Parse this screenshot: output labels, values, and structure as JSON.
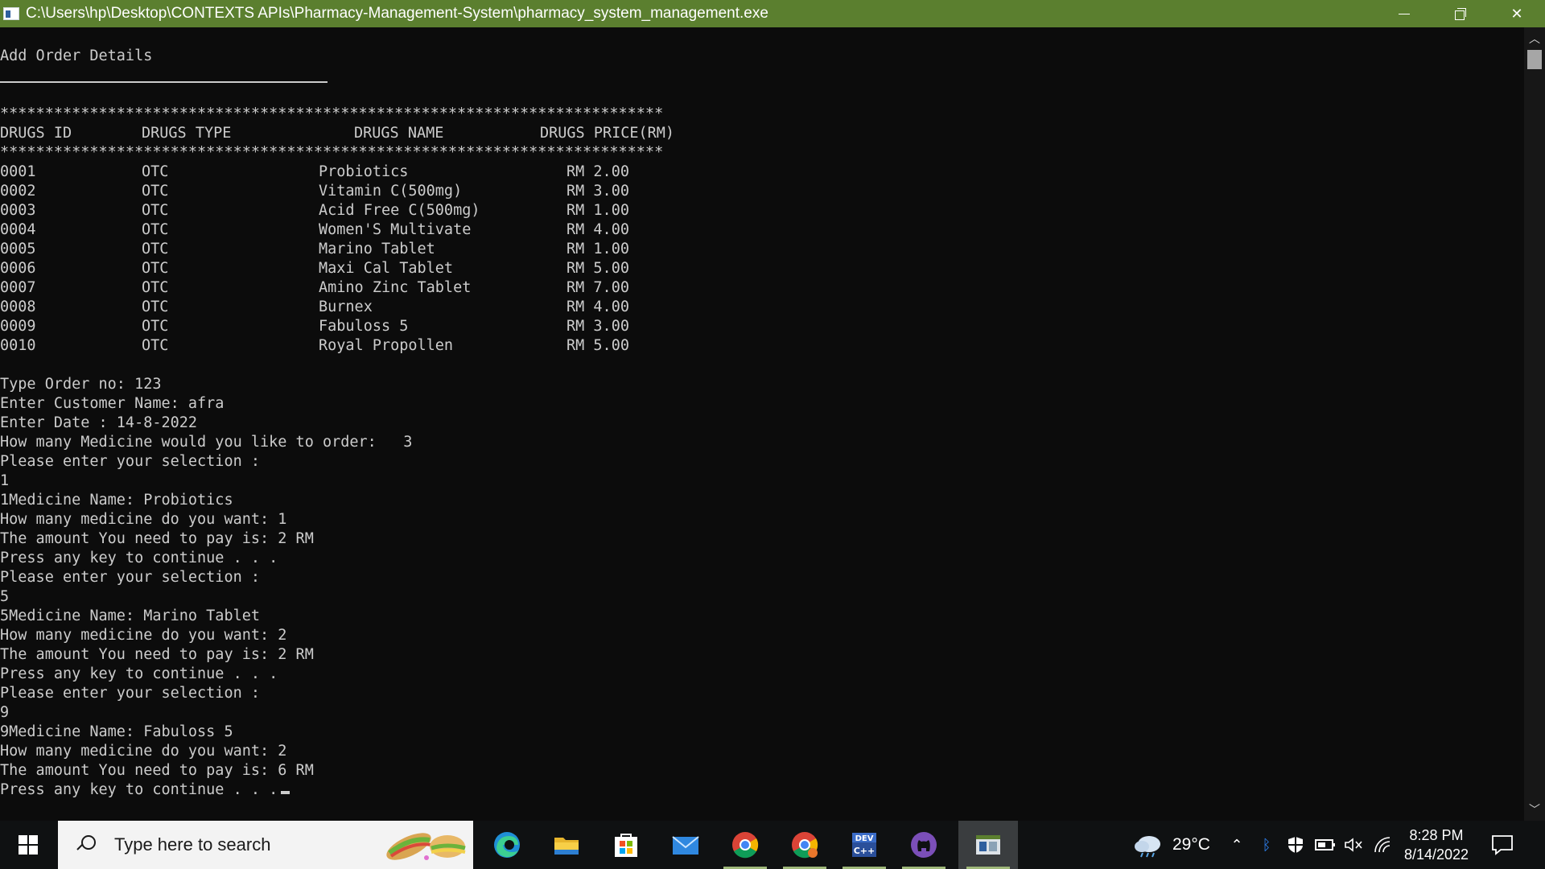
{
  "window": {
    "title": "C:\\Users\\hp\\Desktop\\CONTEXTS APIs\\Pharmacy-Management-System\\pharmacy_system_management.exe",
    "minimize_icon": "minimize-icon",
    "maximize_icon": "restore-icon",
    "close_glyph": "✕"
  },
  "console": {
    "heading": "Add Order Details",
    "separator": "**************************************************************************",
    "headers": [
      "DRUGS ID",
      "DRUGS TYPE",
      "DRUGS NAME",
      "DRUGS PRICE(RM)"
    ],
    "rows": [
      {
        "id": "0001",
        "type": "OTC",
        "name": "Probiotics",
        "price": "RM 2.00"
      },
      {
        "id": "0002",
        "type": "OTC",
        "name": "Vitamin C(500mg)",
        "price": "RM 3.00"
      },
      {
        "id": "0003",
        "type": "OTC",
        "name": "Acid Free C(500mg)",
        "price": "RM 1.00"
      },
      {
        "id": "0004",
        "type": "OTC",
        "name": "Women'S Multivate",
        "price": "RM 4.00"
      },
      {
        "id": "0005",
        "type": "OTC",
        "name": "Marino Tablet",
        "price": "RM 1.00"
      },
      {
        "id": "0006",
        "type": "OTC",
        "name": "Maxi Cal Tablet",
        "price": "RM 5.00"
      },
      {
        "id": "0007",
        "type": "OTC",
        "name": "Amino Zinc Tablet",
        "price": "RM 7.00"
      },
      {
        "id": "0008",
        "type": "OTC",
        "name": "Burnex",
        "price": "RM 4.00"
      },
      {
        "id": "0009",
        "type": "OTC",
        "name": "Fabuloss 5",
        "price": "RM 3.00"
      },
      {
        "id": "0010",
        "type": "OTC",
        "name": "Royal Propollen",
        "price": "RM 5.00"
      }
    ],
    "output_lines": [
      "Type Order no: 123",
      "Enter Customer Name: afra",
      "Enter Date : 14-8-2022",
      "How many Medicine would you like to order:   3",
      "Please enter your selection :",
      "1",
      "1Medicine Name: Probiotics",
      "How many medicine do you want: 1",
      "The amount You need to pay is: 2 RM",
      "Press any key to continue . . .",
      "Please enter your selection :",
      "5",
      "5Medicine Name: Marino Tablet",
      "How many medicine do you want: 2",
      "The amount You need to pay is: 2 RM",
      "Press any key to continue . . .",
      "Please enter your selection :",
      "9",
      "9Medicine Name: Fabuloss 5",
      "How many medicine do you want: 2",
      "The amount You need to pay is: 6 RM",
      "Press any key to continue . . ."
    ]
  },
  "taskbar": {
    "search_placeholder": "Type here to search",
    "apps": [
      "edge-icon",
      "file-explorer-icon",
      "microsoft-store-icon",
      "mail-icon",
      "chrome-icon",
      "chrome-profile-icon",
      "dev-cpp-icon",
      "github-desktop-icon",
      "console-app-icon"
    ],
    "weather_temp": "29°C",
    "time": "8:28 PM",
    "date": "8/14/2022"
  },
  "colors": {
    "titlebar": "#5b7f2f",
    "console_bg": "#0c0c0c",
    "console_text": "#cccccc",
    "taskbar": "#0f1112"
  }
}
